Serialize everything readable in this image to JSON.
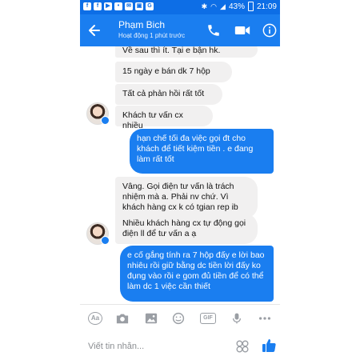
{
  "status_bar": {
    "app_icons": [
      "f",
      "f",
      "▶",
      "•",
      "✉",
      "▣",
      "G"
    ],
    "battery": "43%",
    "time": "21:09"
  },
  "header": {
    "contact_name": "Phạm Bich",
    "contact_status": "Hoạt động 1 phút trước",
    "back_icon": "arrow-left",
    "call_icon": "phone",
    "video_icon": "video-camera",
    "info_icon": "info"
  },
  "messages": [
    {
      "side": "in",
      "text": "Về sau thì ít. Tại e bận hk."
    },
    {
      "side": "in",
      "text": "15 ngày e bán dk 7 hộp"
    },
    {
      "side": "in",
      "text": "Tất cả phản hồi rất tốt"
    },
    {
      "side": "in",
      "text": "Khách tư vấn cx nhiều"
    },
    {
      "side": "out",
      "text": "hạn chế tối đa việc gọi đt cho khách để tiết kiệm tiền . e đang làm rất tốt"
    },
    {
      "side": "in",
      "text": "Vâng. Gọi điện tư vấn là trách nhiệm mà a. Phải nv chứ. Vì khách hàng cx k có tgian rep ib"
    },
    {
      "side": "in",
      "text": "Nhiều khách hàng cx tự động gọi điện ll để tư vấn a ạ"
    },
    {
      "side": "out",
      "text": "e cố gắng tính ra 7 hộp đấy e lời bao nhiêu rồi giữ bằng dc tiền lời đấy ko đụng vào rồi e gom đủ tiền để có thể làm dc 1 việc cần thiết"
    }
  ],
  "toolbar": {
    "aa_label": "Aa",
    "gif_label": "GIF",
    "icons": [
      "aa-icon",
      "camera-icon",
      "image-icon",
      "emoji-icon",
      "gif-icon",
      "microphone-icon",
      "more-icon"
    ]
  },
  "input": {
    "placeholder": "Viết tin nhắn...",
    "value": ""
  },
  "colors": {
    "accent": "#1a7ef0",
    "status_bar": "#0d6ee6",
    "incoming_bubble": "#f1f0f0",
    "icon_gray": "#9a9ea4"
  }
}
